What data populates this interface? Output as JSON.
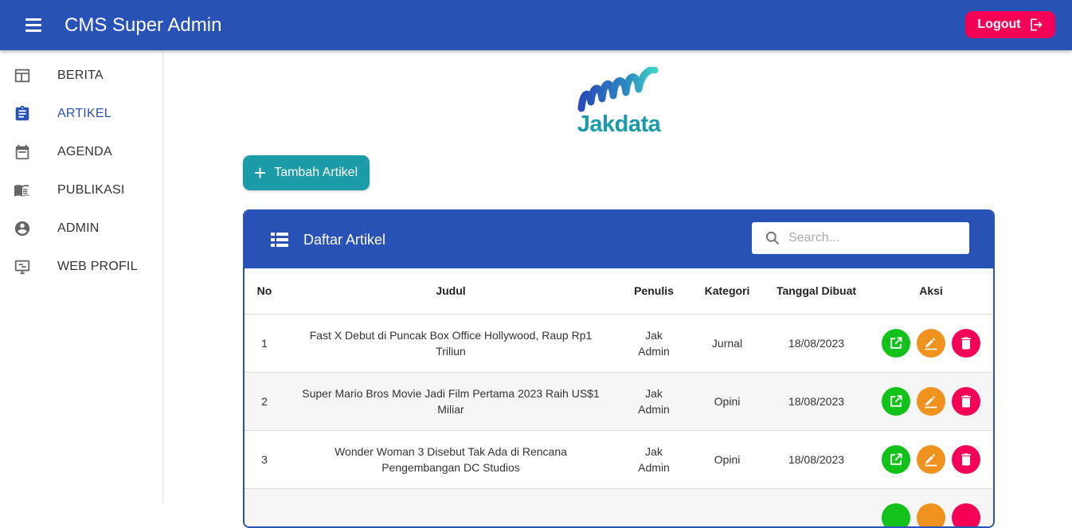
{
  "header": {
    "title": "CMS Super Admin",
    "logout_label": "Logout"
  },
  "sidebar": {
    "items": [
      {
        "label": "BERITA",
        "icon": "newspaper-icon"
      },
      {
        "label": "ARTIKEL",
        "icon": "clipboard-icon",
        "active": true
      },
      {
        "label": "AGENDA",
        "icon": "calendar-icon"
      },
      {
        "label": "PUBLIKASI",
        "icon": "book-icon"
      },
      {
        "label": "ADMIN",
        "icon": "account-circle-icon"
      },
      {
        "label": "WEB PROFIL",
        "icon": "monitor-icon"
      }
    ]
  },
  "logo": {
    "text": "Jakdata"
  },
  "actions": {
    "add_label": "Tambah Artikel"
  },
  "table": {
    "title": "Daftar Artikel",
    "search_placeholder": "Search...",
    "columns": [
      "No",
      "Judul",
      "Penulis",
      "Kategori",
      "Tanggal Dibuat",
      "Aksi"
    ],
    "rows": [
      {
        "no": "1",
        "judul": "Fast X Debut di Puncak Box Office Hollywood, Raup Rp1 Triliun",
        "penulis": "Jak Admin",
        "kategori": "Jurnal",
        "tanggal": "18/08/2023"
      },
      {
        "no": "2",
        "judul": "Super Mario Bros Movie Jadi Film Pertama 2023 Raih US$1 Miliar",
        "penulis": "Jak Admin",
        "kategori": "Opini",
        "tanggal": "18/08/2023"
      },
      {
        "no": "3",
        "judul": "Wonder Woman 3 Disebut Tak Ada di Rencana Pengembangan DC Studios",
        "penulis": "Jak Admin",
        "kategori": "Opini",
        "tanggal": "18/08/2023"
      },
      {
        "no": "",
        "judul": "",
        "penulis": "",
        "kategori": "",
        "tanggal": ""
      }
    ]
  },
  "colors": {
    "primary": "#2852b6",
    "teal": "#1c9ba8",
    "pink": "#f50057",
    "green": "#12c21b",
    "orange": "#f0921e"
  }
}
